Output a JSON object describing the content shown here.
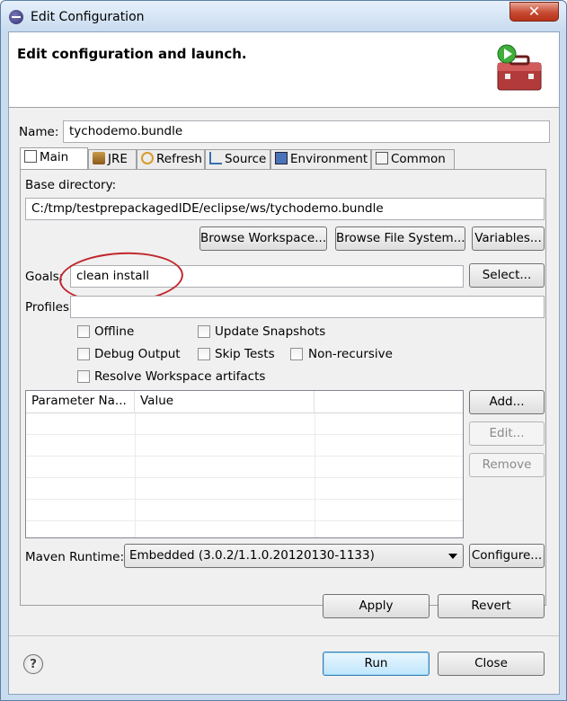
{
  "window": {
    "title": "Edit Configuration",
    "close_glyph": "✕"
  },
  "header": {
    "title": "Edit configuration and launch.",
    "icon": "toolbox-run-icon"
  },
  "name": {
    "label": "Name:",
    "value": "tychodemo.bundle"
  },
  "tabs": [
    {
      "label": "Main",
      "icon": "main-tab-icon",
      "active": true
    },
    {
      "label": "JRE",
      "icon": "jre-icon"
    },
    {
      "label": "Refresh",
      "icon": "refresh-icon"
    },
    {
      "label": "Source",
      "icon": "source-icon"
    },
    {
      "label": "Environment",
      "icon": "environment-icon"
    },
    {
      "label": "Common",
      "icon": "common-icon"
    }
  ],
  "main": {
    "base_dir_label": "Base directory:",
    "base_dir_value": "C:/tmp/testprepackagedIDE/eclipse/ws/tychodemo.bundle",
    "browse_workspace": "Browse Workspace...",
    "browse_fs": "Browse File System...",
    "variables": "Variables...",
    "goals_label": "Goals:",
    "goals_value": "clean install",
    "select": "Select...",
    "profiles_label": "Profiles:",
    "profiles_value": "",
    "checkboxes": {
      "offline": "Offline",
      "update_snapshots": "Update Snapshots",
      "debug_output": "Debug Output",
      "skip_tests": "Skip Tests",
      "non_recursive": "Non-recursive",
      "resolve_workspace": "Resolve Workspace artifacts"
    },
    "table": {
      "col_name": "Parameter Na...",
      "col_value": "Value"
    },
    "add": "Add...",
    "edit": "Edit...",
    "remove": "Remove",
    "runtime_label": "Maven Runtime:",
    "runtime_value": "Embedded (3.0.2/1.1.0.20120130-1133)",
    "configure": "Configure..."
  },
  "actions": {
    "apply": "Apply",
    "revert": "Revert",
    "run": "Run",
    "close": "Close",
    "help": "?"
  },
  "colors": {
    "annotation": "#c0272d",
    "titlebar": "#c9dcef",
    "close": "#c74a32"
  }
}
